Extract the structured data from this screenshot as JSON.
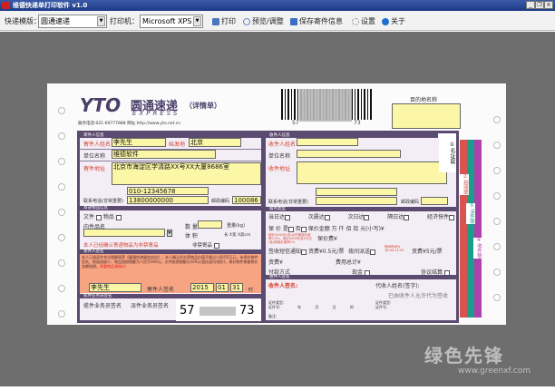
{
  "window": {
    "title": "维德快递单打印软件  v1.0",
    "controls": [
      "_",
      "❐",
      "×"
    ]
  },
  "toolbar": {
    "template_label": "快递模版：",
    "template_value": "圆通速递",
    "printer_label": "打印机：",
    "printer_value": "Microsoft XPS",
    "print": "打印",
    "preview": "预览/调整",
    "save_sender": "保存寄件信息",
    "settings": "设置",
    "about": "关于"
  },
  "waybill": {
    "brand": "圆通速递",
    "brand_en": "EXPRESS",
    "subtitle": "（详情单）",
    "logo_text": "YTO",
    "hotline": "服务电话:021-69777888  网址:http://www.yto.net.cn",
    "barcode_start": "57",
    "barcode_end": "73",
    "destination_label": "目的地名称",
    "destination_value": "",
    "sender": {
      "section": "寄件人信息",
      "name_label": "寄件人姓名",
      "name_value": "李先生",
      "origin_label": "始发地",
      "origin_value": "北京",
      "company_label": "单位名称",
      "company_value": "维德软件",
      "address_label": "寄件地址",
      "address_value": "北京市海淀区学清路XX号XX大厦8686室",
      "phone_label": "联系电话(非常重要)",
      "phone1": "010-12345678",
      "phone2": "13800000000",
      "zip_label": "邮政编码",
      "zip_value": "100086"
    },
    "goods": {
      "section": "寄递物品信息",
      "doc_label": "文件",
      "item_label": "物品",
      "content_label": "内件品名",
      "content_value": "",
      "count_label": "数 量",
      "count_value": "",
      "weight_label": "重量(kg)",
      "volume_label": "体 积",
      "volume_units": "长  X宽  X高cm",
      "declare": "本人已经确认寄递物品为非禁寄品",
      "nonbanned_label": "非禁寄品"
    },
    "signature": {
      "section": "寄件人签名",
      "terms": "本人已阅读并充分理解接受《圆通快递服务协议》，本人确认所交寄物品价值不超过人民币5万元，未保价物件丢失、损毁或缺少，物品赔偿限额为人民币300元，文件赔偿限额为100元(超出部分保价)，保价物件按被保价金额赔偿。",
      "terms_highlight": "贵重物品请保价!",
      "sender_sign_value": "李先生",
      "sign_label": "寄件人签名",
      "year": "2015",
      "month": "01",
      "day": "31",
      "day_unit": "时"
    },
    "staff": {
      "section": "揽件业务员签名",
      "pickup_label": "揽件业务员签名",
      "dispatch_label": "派件业务员签名",
      "barcode_start": "57",
      "barcode_end": "73"
    },
    "receiver": {
      "section": "收件人信息",
      "name_label": "收件人姓名",
      "name_value": "",
      "company_label": "单位名称",
      "company_value": "",
      "address_label": "收件地址",
      "address_value": "",
      "phone_label": "联系电话(非常重要)",
      "phone1": "",
      "phone2": "",
      "zip_label": "邮政编码",
      "zip_value": ""
    },
    "service": {
      "section": "服务类型",
      "options": [
        "当日达",
        "次晨达",
        "次日达",
        "隔日达",
        "经济快件"
      ],
      "insured_label": "保 价 是",
      "insured_no": "否",
      "insured_amount_label": "保价金额",
      "insured_units": "万  仟  佰  拾  元(小写)¥",
      "insured_note": "保价2000元(含)以内按保价费率0.5%，保价2000元至5万元(含)按保价费率1%",
      "insurance_fee_label": "保价费¥",
      "sms_label": "签收短信通知",
      "sms_fee": "资费¥0.5元/票",
      "night_label": "夜间派送",
      "night_time": "夜间时间为18:00-21:00",
      "night_fee": "资费¥5元/票",
      "fee_label": "资费¥",
      "total_label": "费用总计¥",
      "pay_label": "付款方式",
      "cash_label": "现金",
      "agreement_label": "协议结算"
    },
    "receipt": {
      "section": "收件人签名",
      "sign_label": "收件人签名:",
      "agent_label": "代收人姓名(签字):",
      "agent_note": "已由收件人允许代为签收",
      "id_type": "证件类型:",
      "id_no": "证件号:",
      "date_units": [
        "年",
        "月",
        "日",
        "时"
      ],
      "remark_label": "备注:"
    },
    "copies": {
      "first": "①名址联",
      "second": "②结账联",
      "third": "③派件联",
      "fourth": "④收件联"
    }
  },
  "watermark": {
    "text": "绿色先锋",
    "url": "www.greenxf.com"
  },
  "colors": {
    "titlebar": "#1d3a86",
    "workspace": "#6e6e6e",
    "frame": "#5c4b70",
    "field": "#fbf7a6",
    "label_red": "#d8402a",
    "sign_area": "#f7a483"
  }
}
